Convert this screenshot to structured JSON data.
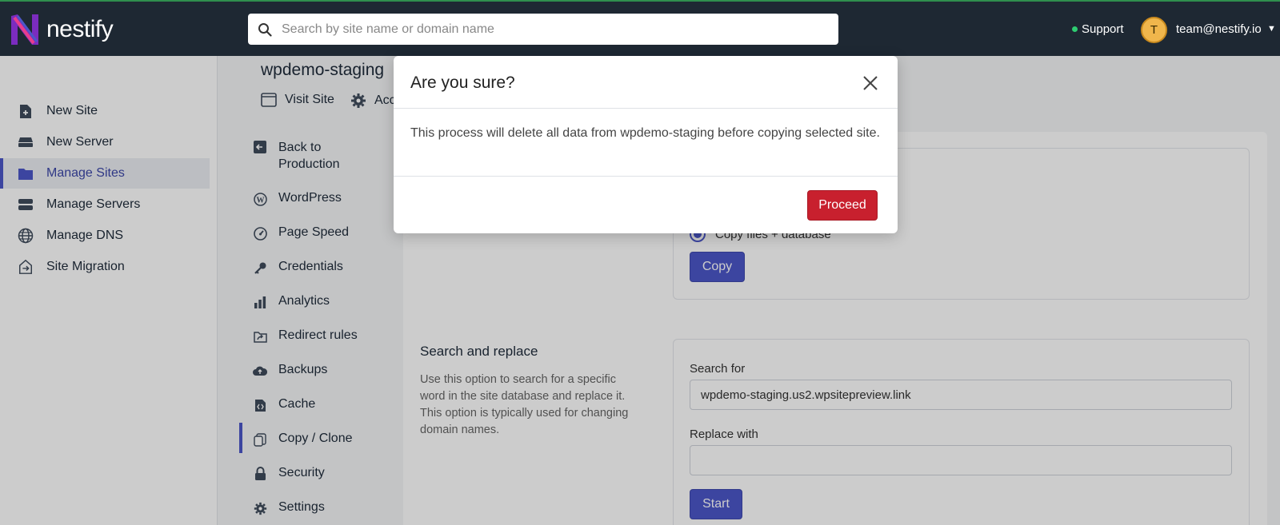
{
  "brand": {
    "name": "nestify"
  },
  "search": {
    "placeholder": "Search by site name or domain name"
  },
  "topbar": {
    "support_label": "Support",
    "avatar_initial": "T",
    "user_email": "team@nestify.io"
  },
  "sidebar": {
    "items": [
      {
        "label": "New Site",
        "icon": "file-plus-icon"
      },
      {
        "label": "New Server",
        "icon": "server-icon"
      },
      {
        "label": "Manage Sites",
        "icon": "folder-icon",
        "active": true
      },
      {
        "label": "Manage Servers",
        "icon": "servers-icon"
      },
      {
        "label": "Manage DNS",
        "icon": "globe-icon"
      },
      {
        "label": "Site Migration",
        "icon": "migration-icon"
      }
    ]
  },
  "page": {
    "title": "wpdemo-staging",
    "visit_site_label": "Visit Site",
    "account_label": "Acc"
  },
  "subnav": {
    "items": [
      {
        "label": "Back to Production",
        "icon": "back-arrow-icon"
      },
      {
        "label": "WordPress",
        "icon": "wordpress-icon"
      },
      {
        "label": "Page Speed",
        "icon": "speedometer-icon"
      },
      {
        "label": "Credentials",
        "icon": "key-icon"
      },
      {
        "label": "Analytics",
        "icon": "bar-chart-icon"
      },
      {
        "label": "Redirect rules",
        "icon": "redirect-icon"
      },
      {
        "label": "Backups",
        "icon": "cloud-upload-icon"
      },
      {
        "label": "Cache",
        "icon": "cache-icon"
      },
      {
        "label": "Copy / Clone",
        "icon": "copy-icon",
        "active": true
      },
      {
        "label": "Security",
        "icon": "lock-icon"
      },
      {
        "label": "Settings",
        "icon": "gear-icon"
      }
    ]
  },
  "copy_section": {
    "radio_label": "Copy files + database",
    "copy_button": "Copy"
  },
  "search_replace": {
    "title": "Search and replace",
    "description": "Use this option to search for a specific word in the site database and replace it. This option is typically used for changing domain names.",
    "search_label": "Search for",
    "search_value": "wpdemo-staging.us2.wpsitepreview.link",
    "replace_label": "Replace with",
    "replace_value": "",
    "start_button": "Start"
  },
  "modal": {
    "title": "Are you sure?",
    "body": "This process will delete all data from wpdemo-staging before copying selected site.",
    "proceed_button": "Proceed"
  },
  "colors": {
    "topbar": "#1e2833",
    "accent": "#4c57c8",
    "danger": "#c8202e"
  }
}
